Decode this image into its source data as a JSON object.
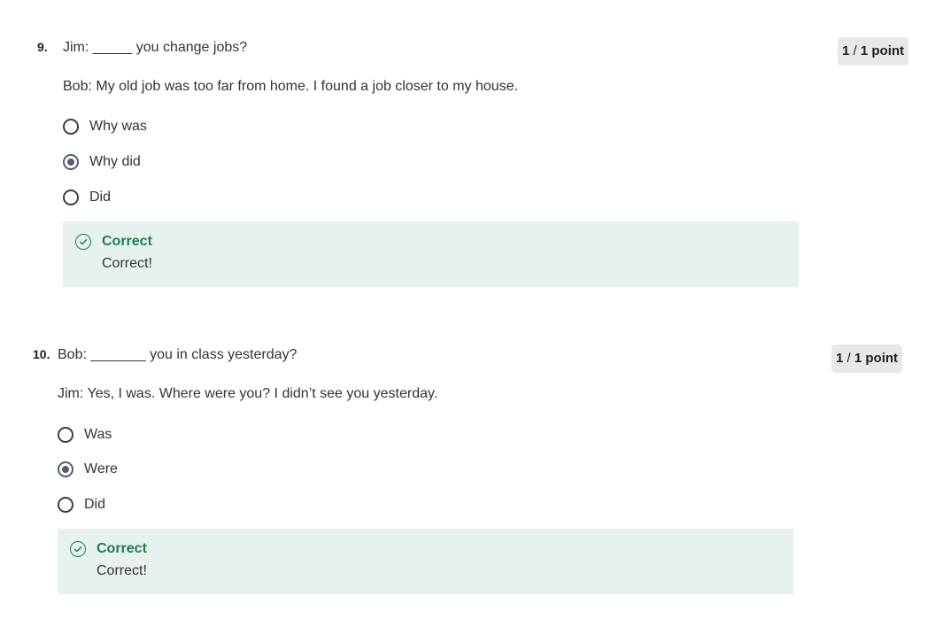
{
  "questions": [
    {
      "number": "9.",
      "prompt": "Jim:  _____ you change jobs?",
      "context": "Bob:  My old job was too far from home. I found a job closer to my house.",
      "score": {
        "earned": "1",
        "sep": " / ",
        "total": "1",
        "unit": " point"
      },
      "options": [
        {
          "label": "Why was",
          "selected": false
        },
        {
          "label": "Why did",
          "selected": true
        },
        {
          "label": "Did",
          "selected": false
        }
      ],
      "feedback": {
        "title": "Correct",
        "text": "Correct!"
      }
    },
    {
      "number": "10.",
      "prompt": "Bob:  _______ you in class yesterday?",
      "context": "Jim:  Yes, I was. Where were you? I didn’t see you yesterday.",
      "score": {
        "earned": "1",
        "sep": " / ",
        "total": "1",
        "unit": " point"
      },
      "options": [
        {
          "label": "Was",
          "selected": false
        },
        {
          "label": "Were",
          "selected": true
        },
        {
          "label": "Did",
          "selected": false
        }
      ],
      "feedback": {
        "title": "Correct",
        "text": "Correct!"
      }
    }
  ],
  "colors": {
    "success": "#1e7d4f",
    "feedback_bg": "#e7f2ee",
    "badge_bg": "#e8e8e8",
    "radio_selected": "#555e6e"
  },
  "icons": {
    "feedback": "check-circle-icon"
  }
}
